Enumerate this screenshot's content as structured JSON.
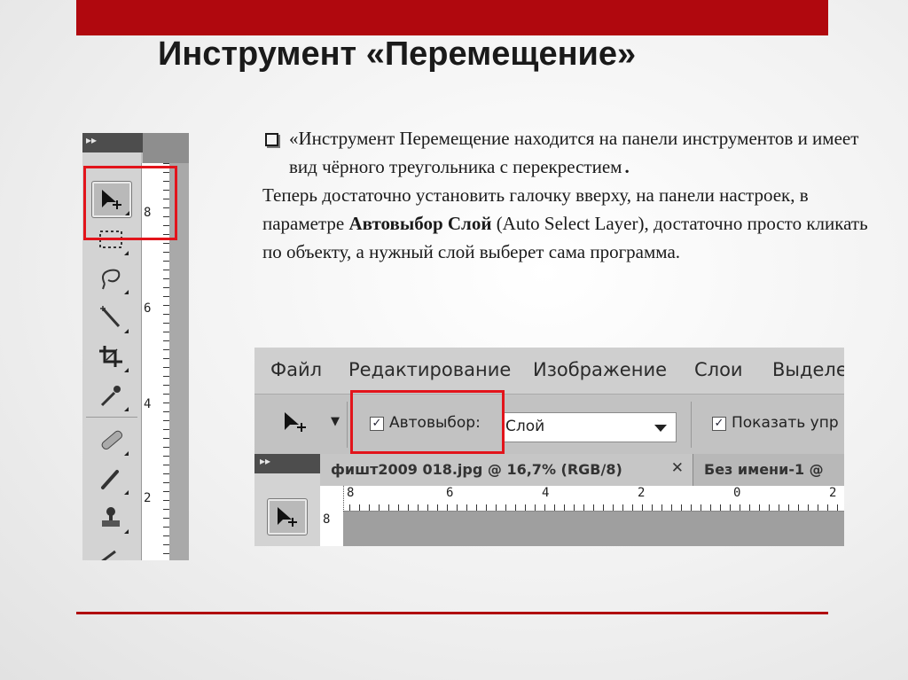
{
  "slide": {
    "title": "Инструмент «Перемещение»",
    "bullet_text": "«Инструмент  Перемещение находится на панели инструментов и имеет вид чёрного треугольника с перекрестием",
    "bullet_end": ".",
    "para_before": "Теперь достаточно установить галочку вверху, на панели настроек, в параметре ",
    "para_bold": "Автовыбор Слой",
    "para_after": " (Auto Select Layer), достаточно просто кликать по объекту, а нужный слой выберет сама программа."
  },
  "toolbox": {
    "header_arrows": "▸▸",
    "tools": [
      "move-tool",
      "marquee-tool",
      "lasso-tool",
      "magic-wand-tool",
      "crop-tool",
      "eyedropper-tool",
      "healing-brush-tool",
      "brush-tool",
      "clone-stamp-tool",
      "history-brush-tool"
    ],
    "ruler_numbers": [
      "8",
      "6",
      "4",
      "2"
    ]
  },
  "photoshop": {
    "menu": [
      "Файл",
      "Редактирование",
      "Изображение",
      "Слои",
      "Выделе"
    ],
    "options": {
      "auto_select_check": "✓",
      "auto_select_label": "Автовыбор:",
      "auto_select_value": "Слой",
      "show_transform_check": "✓",
      "show_transform_label": "Показать упр"
    },
    "panel_header_arrows": "▸▸",
    "tabs": [
      {
        "label": "фишт2009 018.jpg @ 16,7% (RGB/8)",
        "close": "✕"
      },
      {
        "label": "Без имени-1 @"
      }
    ],
    "ruler_numbers": [
      "8",
      "6",
      "4",
      "2",
      "0",
      "2"
    ],
    "vruler_number": "8"
  },
  "colors": {
    "accent_red": "#b0080e",
    "highlight_red": "#e2141b"
  }
}
